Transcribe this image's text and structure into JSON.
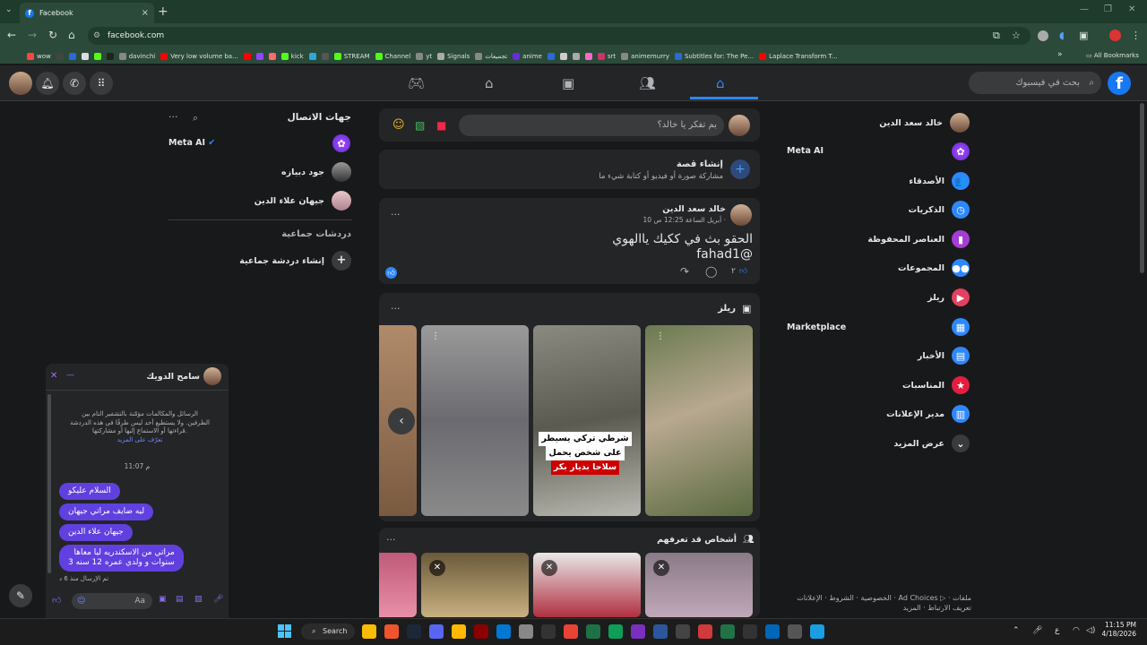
{
  "browser": {
    "tab_title": "Facebook",
    "url": "facebook.com",
    "bookmarks": [
      {
        "label": "wow",
        "color": "#ff4444"
      },
      {
        "label": "",
        "color": "#444444"
      },
      {
        "label": "",
        "color": "#2a6ad6"
      },
      {
        "label": "",
        "color": "#dddddd"
      },
      {
        "label": "",
        "color": "#53fc18"
      },
      {
        "label": "",
        "color": "#222222"
      },
      {
        "label": "davinchi",
        "color": "#888888"
      },
      {
        "label": "Very low volume ba...",
        "color": "#ff0000"
      },
      {
        "label": "",
        "color": "#ff0000"
      },
      {
        "label": "",
        "color": "#9146ff"
      },
      {
        "label": "",
        "color": "#ff6b6b"
      },
      {
        "label": "kick",
        "color": "#53fc18"
      },
      {
        "label": "",
        "color": "#2aa8e0"
      },
      {
        "label": "",
        "color": "#555555"
      },
      {
        "label": "STREAM",
        "color": "#53fc18"
      },
      {
        "label": "Channel",
        "color": "#53fc18"
      },
      {
        "label": "yt",
        "color": "#888888"
      },
      {
        "label": "Signals",
        "color": "#aaaaaa"
      },
      {
        "label": "تجميعات",
        "color": "#888888"
      },
      {
        "label": "anime",
        "color": "#6a2ae0"
      },
      {
        "label": "",
        "color": "#2a6ad6"
      },
      {
        "label": "",
        "color": "#cccccc"
      },
      {
        "label": "",
        "color": "#aaaaaa"
      },
      {
        "label": "",
        "color": "#ff66cc"
      },
      {
        "label": "srt",
        "color": "#cc3366"
      },
      {
        "label": "animemurry",
        "color": "#888888"
      },
      {
        "label": "Subtitles for: The Pe...",
        "color": "#2a6ad6"
      },
      {
        "label": "Laplace Transform T...",
        "color": "#ff0000"
      }
    ],
    "all_bookmarks": "All Bookmarks"
  },
  "header": {
    "search_placeholder": "بحث في فيسبوك",
    "logo": "f"
  },
  "nav_right": {
    "profile_name": "خالد سعد الدين",
    "meta_ai": "Meta AI",
    "items": [
      {
        "label": "الأصدقاء",
        "icon": "friends-icon",
        "color": "#2d88ff",
        "glyph": "👥"
      },
      {
        "label": "الذكريات",
        "icon": "memories-icon",
        "color": "#2d88ff",
        "glyph": "◷"
      },
      {
        "label": "العناصر المحفوظة",
        "icon": "saved-icon",
        "color": "#a63cd6",
        "glyph": "▮"
      },
      {
        "label": "المجموعات",
        "icon": "groups-icon",
        "color": "#2d88ff",
        "glyph": "●●"
      },
      {
        "label": "ريلز",
        "icon": "reels-icon",
        "color": "#e4405f",
        "glyph": "▶"
      },
      {
        "label": "Marketplace",
        "icon": "marketplace-icon",
        "color": "#2d88ff",
        "glyph": "▦"
      },
      {
        "label": "الأخبار",
        "icon": "feeds-icon",
        "color": "#2d88ff",
        "glyph": "▤"
      },
      {
        "label": "المناسبات",
        "icon": "events-icon",
        "color": "#e41e3f",
        "glyph": "★"
      },
      {
        "label": "مدير الإعلانات",
        "icon": "ads-manager-icon",
        "color": "#2d88ff",
        "glyph": "▥"
      },
      {
        "label": "عرض المزيد",
        "icon": "chevron-down-icon",
        "color": "#3a3b3c",
        "glyph": "⌄"
      }
    ],
    "footer": "الخصوصية · الشروط · الإعلانات · Ad Choices ▷ · ملفات تعريف الارتباط · المزيد"
  },
  "feed": {
    "composer_placeholder": "بم تفكر يا خالد؟",
    "story_title": "إنشاء قصة",
    "story_sub": "مشاركة صورة أو فيديو أو كتابة شيء ما",
    "post": {
      "author": "خالد سعد الدين",
      "time": "10 أبريل الساعة 12:25 ص ·",
      "text_line1": "الحقو بث في ككيك ياالهوي",
      "text_line2": "fahad1@",
      "like_count": "٢"
    },
    "reels_title": "ريلز",
    "reel_caption": [
      "شرطي تركي يسيطر",
      "على شخص يحمل",
      "سلاحا بديار بكر"
    ],
    "people_title": "أشخاص قد تعرفهم"
  },
  "contacts": {
    "title": "جهات الاتصال",
    "meta_ai": "Meta AI",
    "people": [
      "جود دبيازه",
      "جيهان علاء الدين"
    ],
    "group_title": "دردشات جماعية",
    "create_group": "إنشاء دردشة جماعية"
  },
  "chat": {
    "name": "سامح الدويك",
    "encryption": "الرسائل والمكالمات مؤمّنة بالتشفير التام بين الطرفين. ولا يستطيع أحد ليس طرفًا في هذه الدردشة قراءتها أو الاستماع إليها أو مشاركتها.",
    "learn_more": "تعرّف على المزيد",
    "time": "11:07 م",
    "messages": [
      "السلام عليكو",
      "ليه ضايف مراتي جيهان",
      "جيهان علاء الدين",
      "مراتي من الاسكندريه ليا معاها",
      "3 سنوات و ولدي عمره 12 سنه"
    ],
    "status": "تم الإرسال منذ 6 د",
    "input_placeholder": "Aa"
  },
  "taskbar": {
    "search": "Search",
    "time": "11:15 PM",
    "date": "4/18/2026",
    "lang": "ع"
  }
}
